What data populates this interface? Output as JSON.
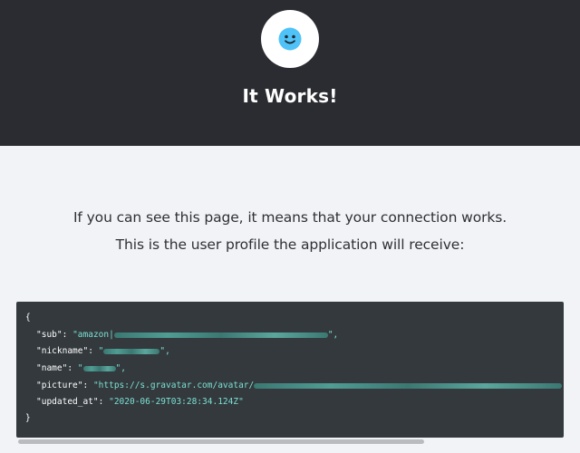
{
  "header": {
    "title": "It Works!",
    "avatar_icon": "smiley-face-icon",
    "background": "#2b2c31",
    "avatar_color": "#4fc3f7"
  },
  "main": {
    "message_line1": "If you can see this page, it means that your connection works.",
    "message_line2": "This is the user profile the application will receive:"
  },
  "profile_json": {
    "open_brace": "{",
    "close_brace": "}",
    "fields": [
      {
        "key": "\"sub\"",
        "value_prefix": "\"amazon|",
        "value_suffix": "\",",
        "redacted": true
      },
      {
        "key": "\"nickname\"",
        "value_prefix": "\"",
        "value_suffix": "\",",
        "redacted": true
      },
      {
        "key": "\"name\"",
        "value_prefix": "\"",
        "value_suffix": "\",",
        "redacted": true
      },
      {
        "key": "\"picture\"",
        "value_prefix": "\"https://s.gravatar.com/avatar/",
        "value_suffix": "",
        "redacted": true
      },
      {
        "key": "\"updated_at\"",
        "value_prefix": "\"2020-06-29T03:28:34.124Z\"",
        "value_suffix": "",
        "redacted": false
      }
    ],
    "colors": {
      "background": "#33393d",
      "string": "#7de0d3"
    }
  }
}
